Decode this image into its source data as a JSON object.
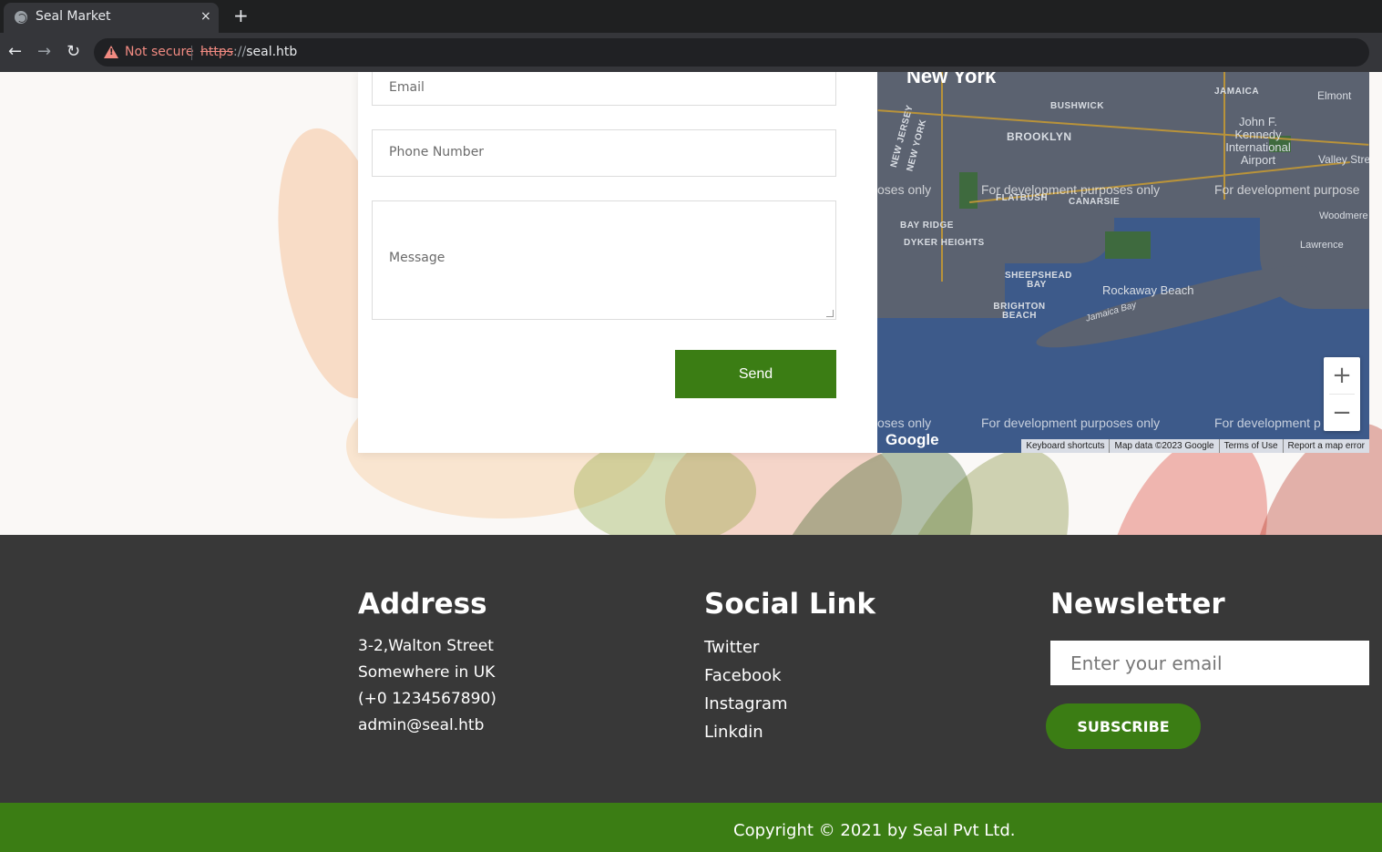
{
  "browser": {
    "tab_title": "Seal Market",
    "tab_close": "×",
    "new_tab": "+",
    "back": "←",
    "forward": "→",
    "reload": "↻",
    "security_label": "Not secure",
    "url_scheme": "https",
    "url_sep": "://",
    "url_host": "seal.htb"
  },
  "contact_form": {
    "email_placeholder": "Email",
    "phone_placeholder": "Phone Number",
    "message_placeholder": "Message",
    "send_label": "Send"
  },
  "map": {
    "labels": {
      "new_york": "New York",
      "brooklyn": "BROOKLYN",
      "bushwick": "BUSHWICK",
      "jamaica": "JAMAICA",
      "elmont": "Elmont",
      "jfk": "John F. Kennedy International Airport",
      "valley_stream": "Valley Stre",
      "flatbush": "FLATBUSH",
      "canarsie": "CANARSIE",
      "bay_ridge": "BAY RIDGE",
      "dyker_heights": "DYKER HEIGHTS",
      "woodmere": "Woodmere",
      "lawrence": "Lawrence",
      "sheepshead_bay": "SHEEPSHEAD BAY",
      "brighton_beach": "BRIGHTON BEACH",
      "rockaway_beach": "Rockaway Beach",
      "jamaica_bay": "Jamaica Bay",
      "new_jersey": "NEW JERSEY",
      "new_york_state": "NEW YORK"
    },
    "watermark_full": "For development purposes only",
    "watermark_left": "oses only",
    "watermark_right": "For development purpose",
    "watermark_right_bottom": "For development p",
    "zoom_in": "+",
    "zoom_out": "−",
    "google_logo": "Google",
    "attribution": {
      "keyboard": "Keyboard shortcuts",
      "map_data": "Map data ©2023 Google",
      "terms": "Terms of Use",
      "report": "Report a map error"
    }
  },
  "footer": {
    "address": {
      "heading": "Address",
      "lines": [
        "3-2,Walton Street",
        "Somewhere in UK",
        "(+0 1234567890)",
        "admin@seal.htb"
      ]
    },
    "social": {
      "heading": "Social Link",
      "links": [
        "Twitter",
        "Facebook",
        "Instagram",
        "Linkdin"
      ]
    },
    "newsletter": {
      "heading": "Newsletter",
      "input_placeholder": "Enter your email",
      "subscribe_label": "SUBSCRIBE"
    },
    "copyright": "Copyright © 2021 by Seal Pvt Ltd."
  },
  "colors": {
    "brand_green": "#3b7d14",
    "footer_bg": "#383838",
    "not_secure": "#f28b82"
  }
}
